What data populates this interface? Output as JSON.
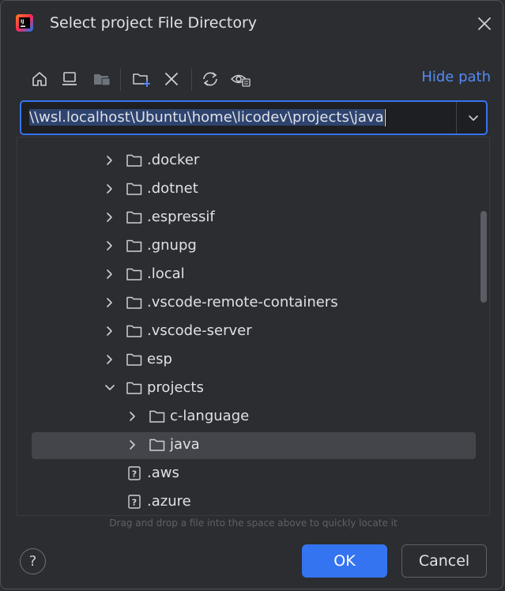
{
  "window": {
    "title": "Select project File Directory",
    "app_icon": "intellij-idea-icon",
    "close_icon": "close-icon"
  },
  "toolbar": {
    "buttons": [
      {
        "name": "home-icon"
      },
      {
        "name": "desktop-icon"
      },
      {
        "name": "project-folder-icon"
      },
      {
        "name": "new-folder-icon"
      },
      {
        "name": "delete-icon"
      },
      {
        "name": "refresh-icon"
      },
      {
        "name": "show-hidden-icon"
      }
    ],
    "hide_path_label": "Hide path"
  },
  "path": {
    "value": "\\\\wsl.localhost\\Ubuntu\\home\\licodev\\projects\\java"
  },
  "tree": {
    "rows": [
      {
        "label": ".docker",
        "indent": 1,
        "expanded": false,
        "type": "folder"
      },
      {
        "label": ".dotnet",
        "indent": 1,
        "expanded": false,
        "type": "folder"
      },
      {
        "label": ".espressif",
        "indent": 1,
        "expanded": false,
        "type": "folder"
      },
      {
        "label": ".gnupg",
        "indent": 1,
        "expanded": false,
        "type": "folder"
      },
      {
        "label": ".local",
        "indent": 1,
        "expanded": false,
        "type": "folder"
      },
      {
        "label": ".vscode-remote-containers",
        "indent": 1,
        "expanded": false,
        "type": "folder"
      },
      {
        "label": ".vscode-server",
        "indent": 1,
        "expanded": false,
        "type": "folder"
      },
      {
        "label": "esp",
        "indent": 1,
        "expanded": false,
        "type": "folder"
      },
      {
        "label": "projects",
        "indent": 1,
        "expanded": true,
        "type": "folder"
      },
      {
        "label": "c-language",
        "indent": 2,
        "expanded": false,
        "type": "folder"
      },
      {
        "label": "java",
        "indent": 2,
        "expanded": false,
        "type": "folder",
        "selected": true
      },
      {
        "label": ".aws",
        "indent": 1,
        "type": "unknown-file"
      },
      {
        "label": ".azure",
        "indent": 1,
        "type": "unknown-file"
      }
    ]
  },
  "hint": "Drag and drop a file into the space above to quickly locate it",
  "buttons": {
    "help": "?",
    "ok": "OK",
    "cancel": "Cancel"
  },
  "colors": {
    "background": "#2b2d30",
    "accent": "#3574f0",
    "link": "#548af7",
    "selection": "#43454a"
  }
}
